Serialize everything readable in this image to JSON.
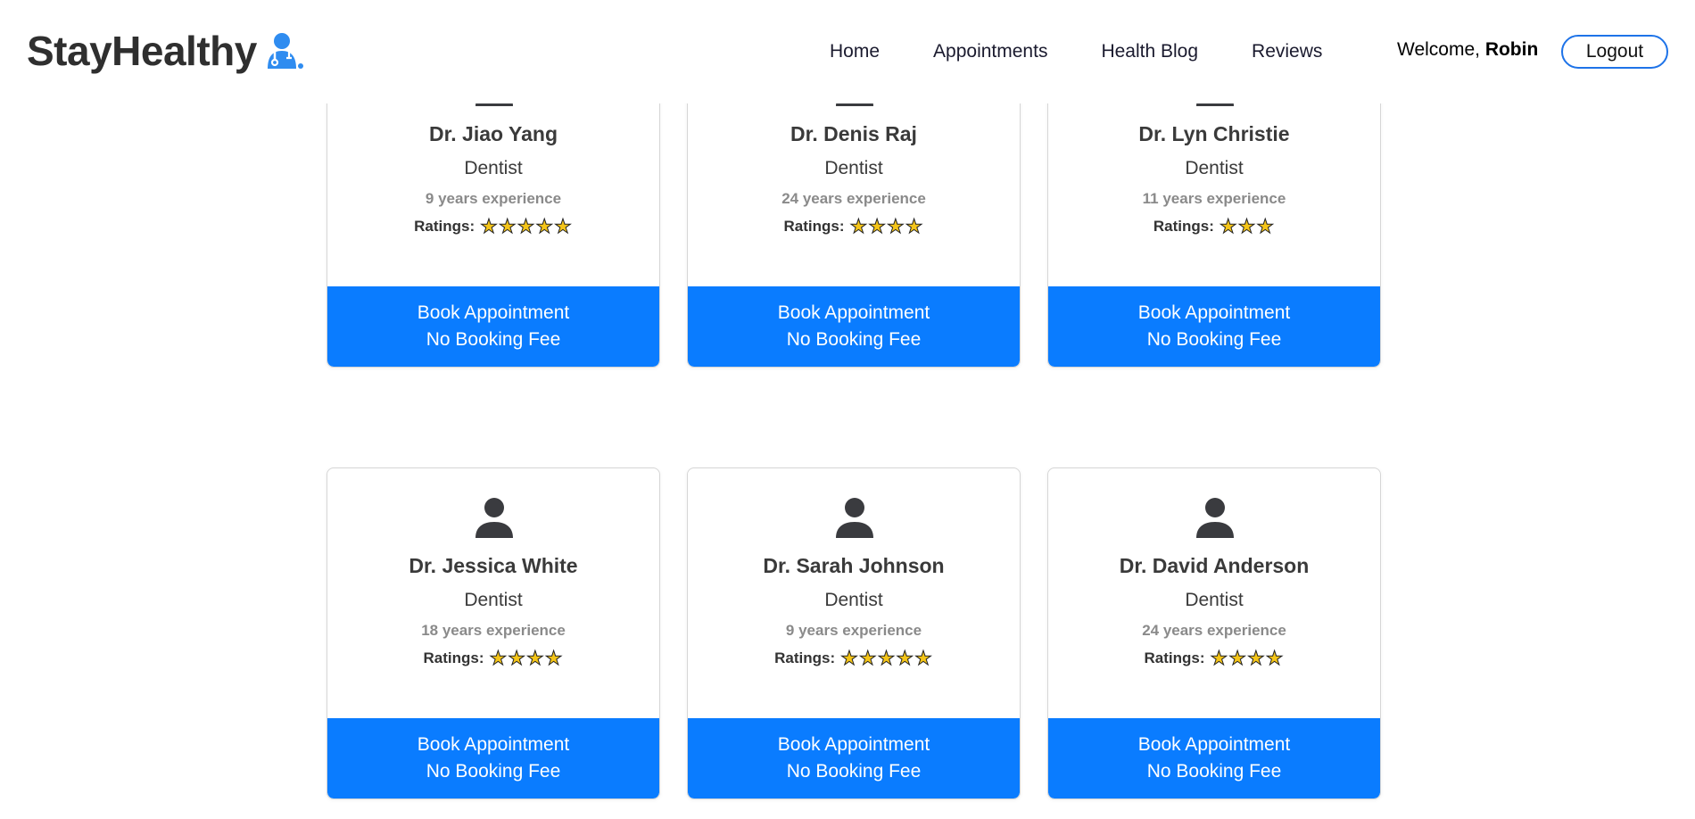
{
  "brand": {
    "name": "StayHealthy",
    "logo_icon": "doctor-icon"
  },
  "nav": {
    "links": [
      "Home",
      "Appointments",
      "Health Blog",
      "Reviews"
    ],
    "welcome_prefix": "Welcome, ",
    "user_name": "Robin",
    "logout_label": "Logout"
  },
  "colors": {
    "primary": "#0a7cff",
    "star": "#f5c518",
    "text": "#3a3a3a",
    "muted": "#8a8a8a"
  },
  "doctors": [
    {
      "name": "Dr. Jiao Yang",
      "speciality": "Dentist",
      "experience": "9 years experience",
      "ratings_label": "Ratings:",
      "stars": 5,
      "book_line1": "Book Appointment",
      "book_line2": "No Booking Fee"
    },
    {
      "name": "Dr. Denis Raj",
      "speciality": "Dentist",
      "experience": "24 years experience",
      "ratings_label": "Ratings:",
      "stars": 4,
      "book_line1": "Book Appointment",
      "book_line2": "No Booking Fee"
    },
    {
      "name": "Dr. Lyn Christie",
      "speciality": "Dentist",
      "experience": "11 years experience",
      "ratings_label": "Ratings:",
      "stars": 3,
      "book_line1": "Book Appointment",
      "book_line2": "No Booking Fee"
    },
    {
      "name": "Dr. Jessica White",
      "speciality": "Dentist",
      "experience": "18 years experience",
      "ratings_label": "Ratings:",
      "stars": 4,
      "book_line1": "Book Appointment",
      "book_line2": "No Booking Fee"
    },
    {
      "name": "Dr. Sarah Johnson",
      "speciality": "Dentist",
      "experience": "9 years experience",
      "ratings_label": "Ratings:",
      "stars": 5,
      "book_line1": "Book Appointment",
      "book_line2": "No Booking Fee"
    },
    {
      "name": "Dr. David Anderson",
      "speciality": "Dentist",
      "experience": "24 years experience",
      "ratings_label": "Ratings:",
      "stars": 4,
      "book_line1": "Book Appointment",
      "book_line2": "No Booking Fee"
    }
  ]
}
